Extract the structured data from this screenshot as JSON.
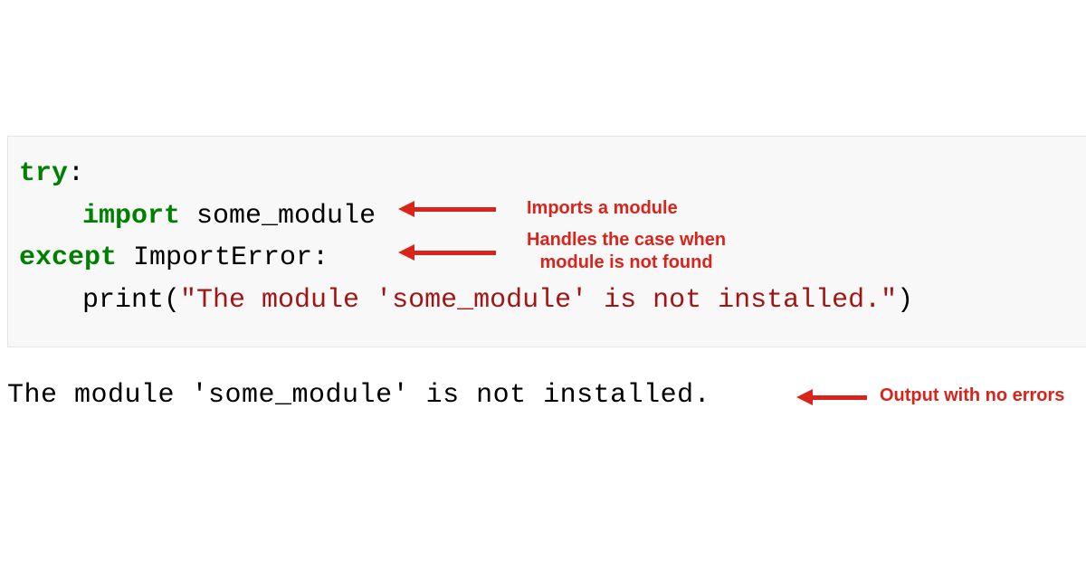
{
  "code": {
    "line1_kw": "try",
    "line1_colon": ":",
    "line2_kw": "import",
    "line2_module": " some_module",
    "line3_kw": "except",
    "line3_err": " ImportError",
    "line3_colon": ":",
    "line4_func": "print",
    "line4_paren_open": "(",
    "line4_str": "\"The module 'some_module' is not installed.\"",
    "line4_paren_close": ")"
  },
  "output": {
    "text": "The module 'some_module' is not installed."
  },
  "annotations": {
    "a1": "Imports a module",
    "a2_l1": "Handles the case when",
    "a2_l2": "module is not found",
    "a3": "Output with no errors"
  }
}
